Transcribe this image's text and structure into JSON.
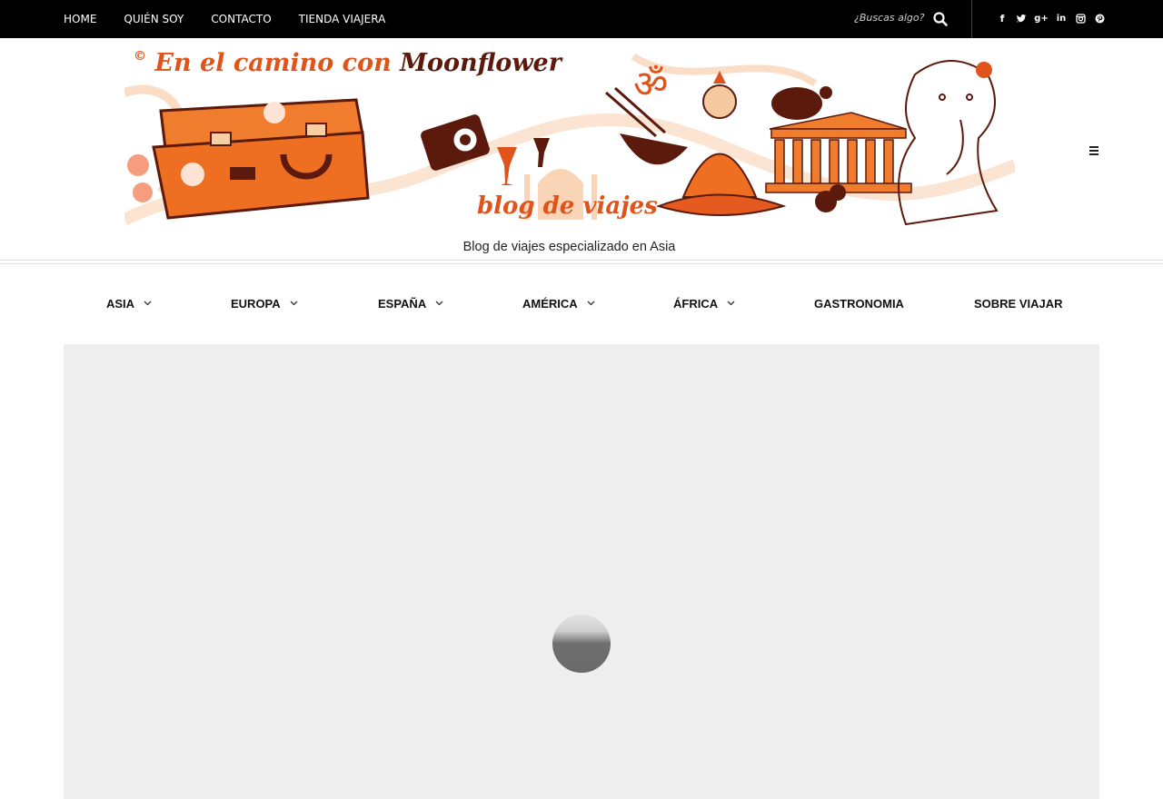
{
  "topnav": {
    "items": [
      "HOME",
      "QUIÉN SOY",
      "CONTACTO",
      "TIENDA VIAJERA"
    ]
  },
  "search": {
    "placeholder": "¿Buscas algo?",
    "icon": "search-icon"
  },
  "social": {
    "icons": [
      "facebook-icon",
      "twitter-icon",
      "google-plus-icon",
      "linkedin-icon",
      "instagram-icon",
      "pinterest-icon"
    ]
  },
  "banner": {
    "title_prefix": "En el camino con",
    "title_brand": "Moonflower",
    "subtitle": "blog de viajes",
    "colors": {
      "orange": "#e0531a",
      "brown": "#5b1a0c"
    }
  },
  "tagline": "Blog de viajes especializado en Asia",
  "mainnav": {
    "items": [
      {
        "label": "ASIA",
        "has_dropdown": true
      },
      {
        "label": "EUROPA",
        "has_dropdown": true
      },
      {
        "label": "ESPAÑA",
        "has_dropdown": true
      },
      {
        "label": "AMÉRICA",
        "has_dropdown": true
      },
      {
        "label": "ÁFRICA",
        "has_dropdown": true
      },
      {
        "label": "GASTRONOMIA",
        "has_dropdown": false
      },
      {
        "label": "SOBRE VIAJAR",
        "has_dropdown": false
      }
    ]
  }
}
